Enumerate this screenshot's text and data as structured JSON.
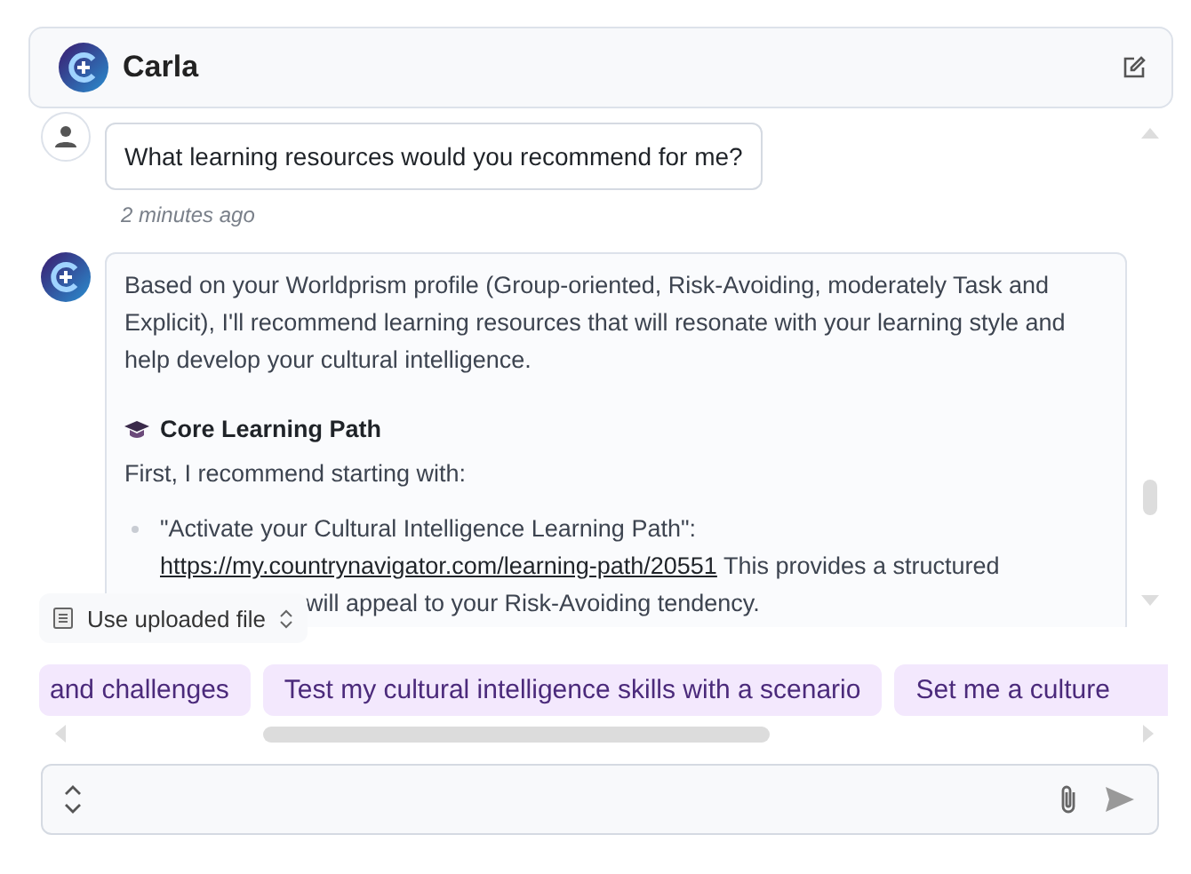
{
  "header": {
    "title": "Carla"
  },
  "messages": [
    {
      "kind": "user",
      "text": "What learning resources would you recommend for me?",
      "time": "2 minutes ago"
    },
    {
      "kind": "assistant",
      "intro": "Based on your Worldprism profile (Group-oriented, Risk-Avoiding, moderately Task and Explicit), I'll recommend learning resources that will resonate with your learning style and help develop your cultural intelligence.",
      "heading": "Core Learning Path",
      "lead": "First, I recommend starting with:",
      "bullet": {
        "title": "\"Activate your Cultural Intelligence Learning Path\":",
        "link": "https://my.countrynavigator.com/learning-path/20551",
        "after": "This provides a structured",
        "tail": "will appeal to your Risk-Avoiding tendency."
      }
    }
  ],
  "source_select": {
    "value": "Use uploaded file"
  },
  "suggestions": [
    {
      "label": "and challenges"
    },
    {
      "label": "Test my cultural intelligence skills with a scenario"
    },
    {
      "label": "Set me a culture"
    }
  ]
}
